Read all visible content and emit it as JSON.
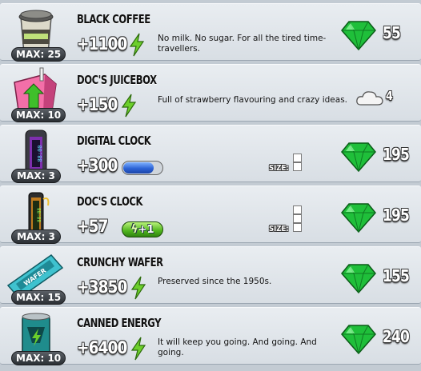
{
  "items": [
    {
      "name": "BLACK COFFEE",
      "max": "MAX: 25",
      "energy": "+1100",
      "description": "No milk. No sugar. For all the tired time-travellers.",
      "currency": "gem-icon",
      "price": "55"
    },
    {
      "name": "DOC'S JUICEBOX",
      "max": "MAX: 10",
      "energy": "+150",
      "description": "Full of strawberry flavouring and crazy ideas.",
      "currency": "cloud-icon",
      "price": "4"
    },
    {
      "name": "DIGITAL CLOCK",
      "max": "MAX: 3",
      "energy": "+300",
      "size_label": "SIZE:",
      "size_units": 1,
      "currency": "gem-icon",
      "price": "195"
    },
    {
      "name": "DOC'S CLOCK",
      "max": "MAX: 3",
      "energy": "+57",
      "boost": "+1",
      "size_label": "SIZE:",
      "size_units": 2,
      "currency": "gem-icon",
      "price": "195"
    },
    {
      "name": "CRUNCHY WAFER",
      "max": "MAX: 15",
      "energy": "+3850",
      "description": "Preserved since the 1950s.",
      "currency": "gem-icon",
      "price": "155"
    },
    {
      "name": "CANNED ENERGY",
      "max": "MAX: 10",
      "energy": "+6400",
      "description": "It will keep you going. And going. And going.",
      "currency": "gem-icon",
      "price": "240"
    }
  ],
  "colors": {
    "gem": "#1fbf3a",
    "energy_bolt": "#6ccf2b",
    "panel": "#dfe4e9"
  }
}
